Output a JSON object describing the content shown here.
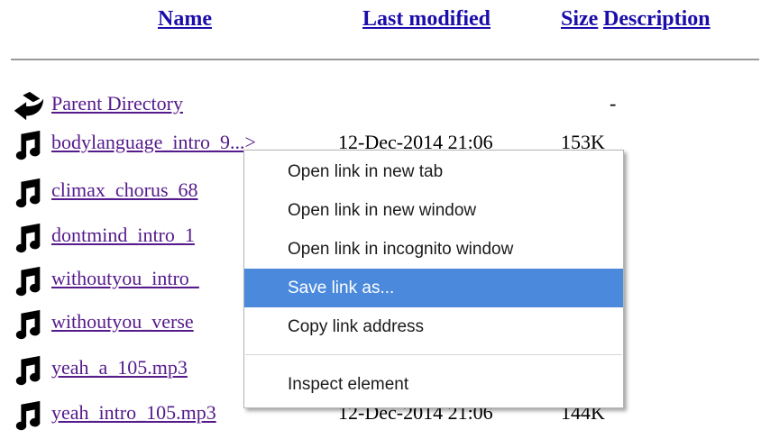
{
  "header": {
    "name": "Name",
    "last_modified": "Last modified",
    "size": "Size",
    "description": "Description"
  },
  "parent": {
    "label": "Parent Directory",
    "size": "-"
  },
  "files": [
    {
      "name": "bodylanguage_intro_9...>",
      "date": "12-Dec-2014 21:06",
      "size": "153K"
    },
    {
      "name": "climax_chorus_68",
      "date": "",
      "size": ""
    },
    {
      "name": "dontmind_intro_1",
      "date": "",
      "size": ""
    },
    {
      "name": "withoutyou_intro_",
      "date": "",
      "size": ""
    },
    {
      "name": "withoutyou_verse",
      "date": "",
      "size": ""
    },
    {
      "name": "yeah_a_105.mp3",
      "date": "",
      "size": ""
    },
    {
      "name": "yeah_intro_105.mp3",
      "date": "12-Dec-2014 21:06",
      "size": "144K"
    }
  ],
  "context_menu": {
    "items": [
      "Open link in new tab",
      "Open link in new window",
      "Open link in incognito window",
      "Save link as...",
      "Copy link address",
      "Inspect element"
    ],
    "highlighted": "Save link as..."
  },
  "icons": {
    "parent": "back-arrow-icon",
    "file": "music-note-icon"
  }
}
